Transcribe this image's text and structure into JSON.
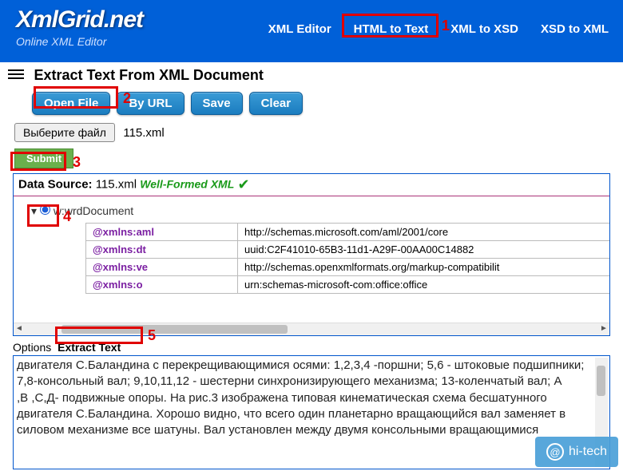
{
  "header": {
    "logo": "XmlGrid.net",
    "tagline": "Online XML Editor",
    "nav": {
      "xml_editor": "XML Editor",
      "html_to_text": "HTML to Text",
      "xml_to_xsd": "XML to XSD",
      "xsd_to_xml": "XSD to XML"
    }
  },
  "page": {
    "title": "Extract Text From XML Document"
  },
  "toolbar": {
    "open_file": "Open File",
    "by_url": "By URL",
    "save": "Save",
    "clear": "Clear"
  },
  "file_picker": {
    "button": "Выберите файл",
    "filename": "115.xml"
  },
  "submit": {
    "label": "Submit"
  },
  "data_source": {
    "label": "Data Source:",
    "file": "115.xml",
    "status": "Well-Formed XML"
  },
  "tree": {
    "root_prefix": "w:w",
    "root_suffix": "rdDocument",
    "attrs": [
      {
        "name": "@xmlns:aml",
        "value": "http://schemas.microsoft.com/aml/2001/core"
      },
      {
        "name": "@xmlns:dt",
        "value": "uuid:C2F41010-65B3-11d1-A29F-00AA00C14882"
      },
      {
        "name": "@xmlns:ve",
        "value": "http://schemas.openxmlformats.org/markup-compatibilit"
      },
      {
        "name": "@xmlns:o",
        "value": "urn:schemas-microsoft-com:office:office"
      }
    ]
  },
  "tabs": {
    "options": "Options",
    "extract": "Extract Text"
  },
  "extracted_text": "двигателя С.Баландина с перекрещивающимися осями: 1,2,3,4 -поршни; 5,6 - штоковые подшипники; 7,8-консольный вал; 9,10,11,12 - шестерни синхронизирующего механизма; 13-коленчатый вал; А\n,В ,С,Д- подвижные опоры. На рис.3 изображена типовая кинематическая схема бесшатунного двигателя С.Баландина. Хорошо видно, что всего один планетарно вращающийся вал заменяет в силовом механизме все шатуны. Вал установлен между двумя консольными вращающимися",
  "annotations": {
    "n1": "1",
    "n2": "2",
    "n3": "3",
    "n4": "4",
    "n5": "5"
  },
  "watermark": {
    "text": "hi-tech"
  }
}
